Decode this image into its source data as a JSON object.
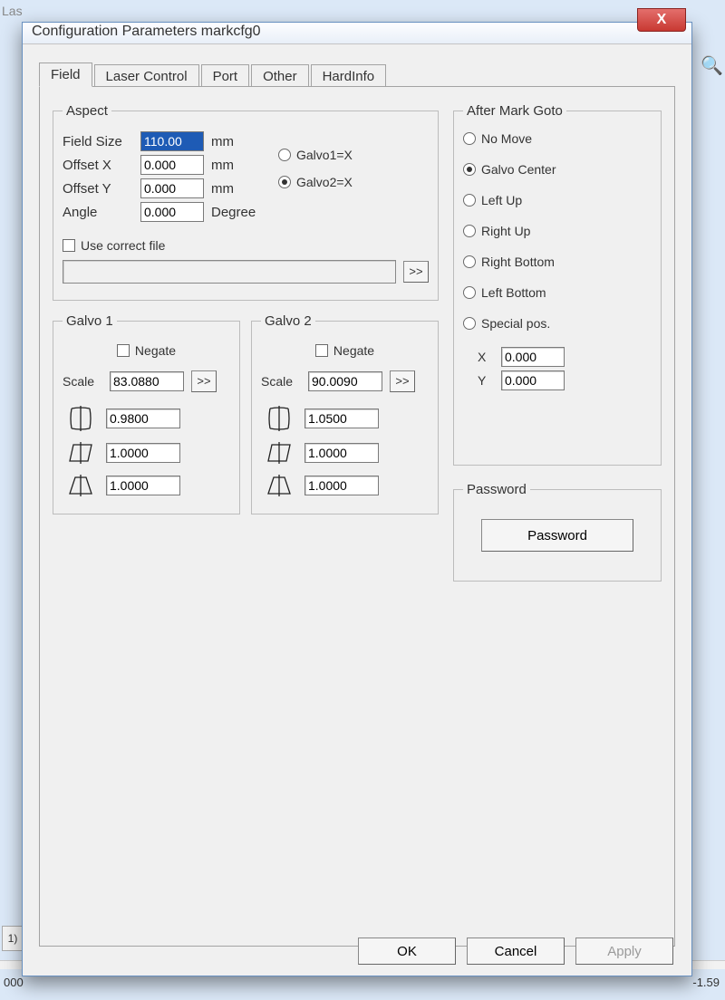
{
  "bg": {
    "app": "Las",
    "coord": "000",
    "right_num": "-1.59",
    "btn1": "1)"
  },
  "dialog": {
    "title": "Configuration Parameters markcfg0",
    "close": "X",
    "tabs": [
      "Field",
      "Laser Control",
      "Port",
      "Other",
      "HardInfo"
    ],
    "active_tab": 0,
    "buttons": {
      "ok": "OK",
      "cancel": "Cancel",
      "apply": "Apply"
    }
  },
  "aspect": {
    "legend": "Aspect",
    "field_size_label": "Field Size",
    "field_size": "110.00",
    "offset_x_label": "Offset X",
    "offset_x": "0.000",
    "offset_y_label": "Offset Y",
    "offset_y": "0.000",
    "angle_label": "Angle",
    "angle": "0.000",
    "unit_mm": "mm",
    "unit_deg": "Degree",
    "galvo_opt1": "Galvo1=X",
    "galvo_opt2": "Galvo2=X",
    "galvo_selected": 2,
    "use_correct_label": "Use correct file",
    "browse": ">>"
  },
  "goto": {
    "legend": "After Mark Goto",
    "options": [
      "No Move",
      "Galvo Center",
      "Left Up",
      "Right Up",
      "Right Bottom",
      "Left Bottom",
      "Special pos."
    ],
    "selected": 1,
    "x_label": "X",
    "x": "0.000",
    "y_label": "Y",
    "y": "0.000"
  },
  "galvo1": {
    "legend": "Galvo 1",
    "negate": "Negate",
    "scale_label": "Scale",
    "scale": "83.0880",
    "browse": ">>",
    "v1": "0.9800",
    "v2": "1.0000",
    "v3": "1.0000"
  },
  "galvo2": {
    "legend": "Galvo 2",
    "negate": "Negate",
    "scale_label": "Scale",
    "scale": "90.0090",
    "browse": ">>",
    "v1": "1.0500",
    "v2": "1.0000",
    "v3": "1.0000"
  },
  "password": {
    "legend": "Password",
    "button": "Password"
  }
}
